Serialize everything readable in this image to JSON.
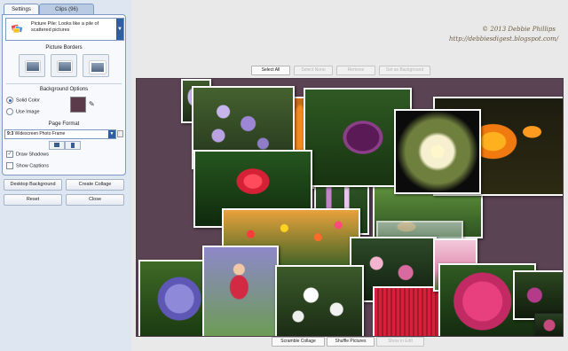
{
  "panel": {
    "tabs": [
      {
        "label": "Settings",
        "active": true
      },
      {
        "label": "Clips (96)",
        "active": false
      }
    ],
    "collage_style": {
      "name": "Picture Pile:",
      "description": "Looks like a pile of scattered pictures"
    },
    "picture_borders": {
      "title": "Picture Borders"
    },
    "background_options": {
      "title": "Background Options",
      "solid_color_label": "Solid Color",
      "use_image_label": "Use Image",
      "selected": "solid_color",
      "color": "#5b3b4a"
    },
    "page_format": {
      "title": "Page Format",
      "ratio": "9:3",
      "label": "Widescreen Photo Frame"
    },
    "draw_shadows": {
      "label": "Draw Shadows",
      "checked": true
    },
    "show_captions": {
      "label": "Show Captions",
      "checked": false
    },
    "buttons": {
      "desktop_background": "Desktop Background",
      "create_collage": "Create Collage",
      "reset": "Reset",
      "close": "Close"
    }
  },
  "watermark": {
    "line1": "© 2013 Debbie Phillips",
    "line2": "http://debbiesdigest.blogspot.com/"
  },
  "toolbar_top": {
    "select_all": "Select All",
    "select_none": "Select None",
    "remove": "Remove",
    "set_as_background": "Set as Background"
  },
  "toolbar_bottom": {
    "scramble_collage": "Scramble Collage",
    "shuffle_pictures": "Shuffle Pictures",
    "show_in_edit": "Show in Edit"
  },
  "colors": {
    "canvas_background": "#5a4352",
    "panel_background": "#dde6f1",
    "accent": "#2e5fa3"
  }
}
